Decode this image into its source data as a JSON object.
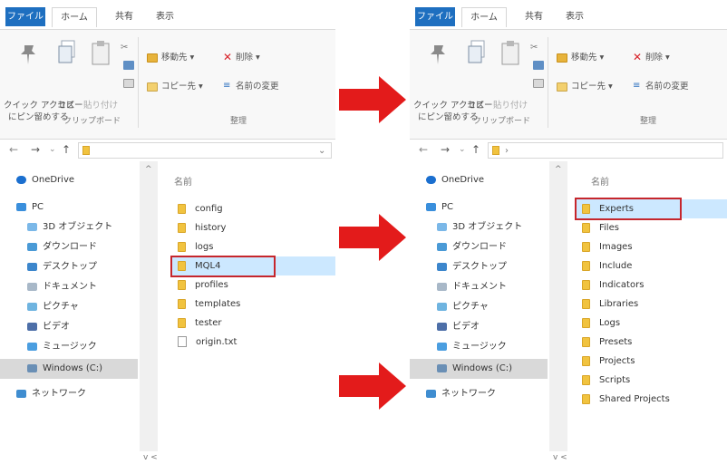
{
  "ribbon": {
    "tabs": {
      "file": "ファイル",
      "home": "ホーム",
      "share": "共有",
      "view": "表示"
    },
    "pin_label_1": "クイック アクセス",
    "pin_label_2": "にピン留めする",
    "copy_label": "コピー",
    "paste_label": "貼り付け",
    "clipboard_group": "クリップボード",
    "move_to": "移動先 ▾",
    "delete": "削除 ▾",
    "copy_to": "コピー先 ▾",
    "rename": "名前の変更",
    "organize_group": "整理"
  },
  "nav_pane": {
    "items": [
      "OneDrive",
      "PC",
      "3D オブジェクト",
      "ダウンロード",
      "デスクトップ",
      "ドキュメント",
      "ピクチャ",
      "ビデオ",
      "ミュージック",
      "Windows (C:)",
      "ネットワーク"
    ],
    "selected": "Windows (C:)"
  },
  "left": {
    "column_header": "名前",
    "files": [
      "config",
      "history",
      "logs",
      "MQL4",
      "profiles",
      "templates",
      "tester",
      "origin.txt"
    ],
    "highlighted": "MQL4"
  },
  "right": {
    "column_header": "名前",
    "files": [
      "Experts",
      "Files",
      "Images",
      "Include",
      "Indicators",
      "Libraries",
      "Logs",
      "Presets",
      "Projects",
      "Scripts",
      "Shared Projects"
    ],
    "highlighted": "Experts"
  },
  "colors": {
    "accent": "#1e6fc0",
    "highlight": "#cce8ff",
    "red": "#e31b1b",
    "folder": "#f1c33f"
  }
}
